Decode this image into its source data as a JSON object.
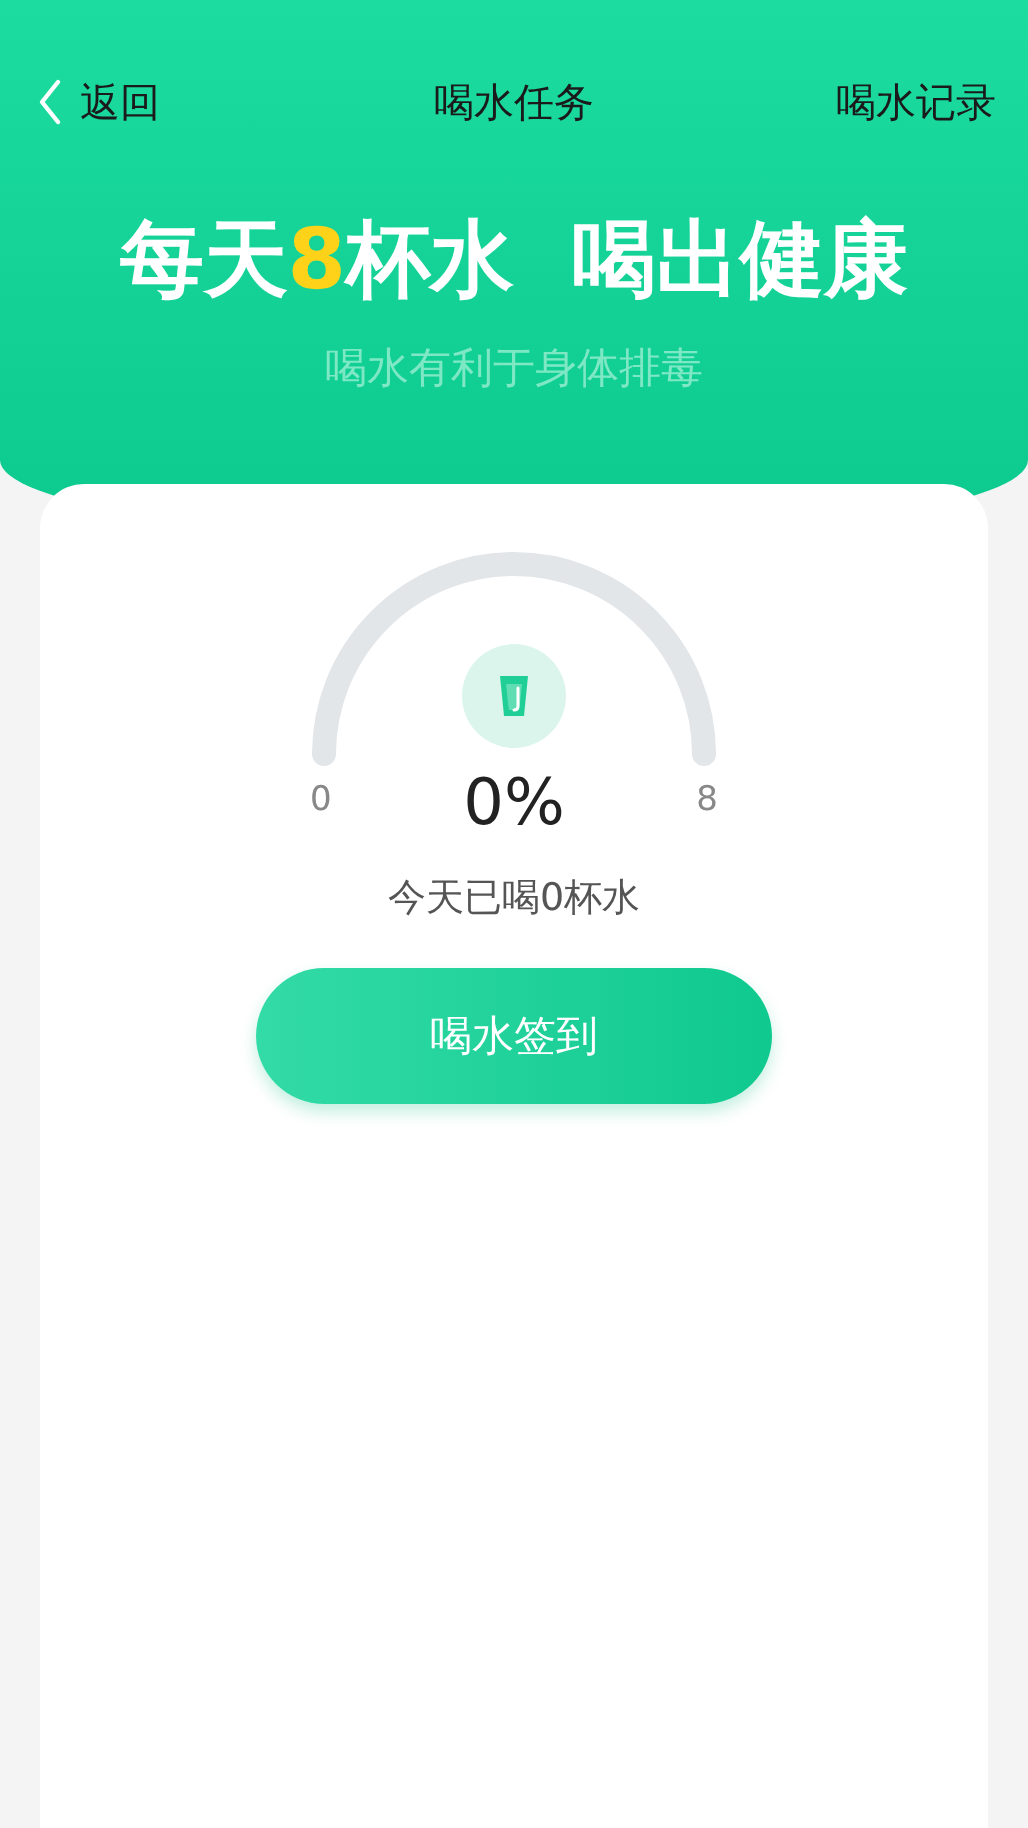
{
  "nav": {
    "back": "返回",
    "title": "喝水任务",
    "action": "喝水记录"
  },
  "headline": [
    {
      "text": "每天",
      "highlight": false
    },
    {
      "text": "8",
      "highlight": true
    },
    {
      "text": "杯水  喝出健康",
      "highlight": false
    }
  ],
  "subtitle": "喝水有利于身体排毒",
  "gauge": {
    "min": "0",
    "max": "8",
    "percent": "0%"
  },
  "today": "今天已喝0杯水",
  "button": "喝水签到"
}
